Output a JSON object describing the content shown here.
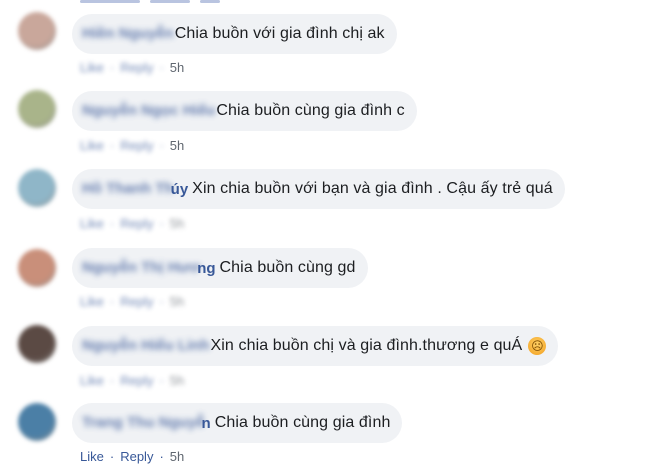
{
  "colors": {
    "bubble_bg": "#f0f2f5",
    "name": "#385898",
    "text": "#1c1e21",
    "meta": "#606770"
  },
  "comments": [
    {
      "avatar_color": "#c9a79b",
      "name_blurred": "Hiền Nguyễn",
      "name_tail": "",
      "text": "Chia buồn với gia đình chị ak",
      "like_label": "Like",
      "reply_label": "Reply",
      "time": "5h",
      "emoji": ""
    },
    {
      "avatar_color": "#a9b48a",
      "name_blurred": "Nguyễn Ngọc Hiếu",
      "name_tail": "",
      "text": "Chia buồn cùng gia đình c",
      "like_label": "Like",
      "reply_label": "Reply",
      "time": "5h",
      "emoji": ""
    },
    {
      "avatar_color": "#8fb6c8",
      "name_blurred": "Hồ Thanh Th",
      "name_tail": "úy",
      "text": "Xin chia buồn với bạn và gia đình . Cậu ấy trẻ quá",
      "like_label": "Like",
      "reply_label": "Reply",
      "time": "5h",
      "emoji": ""
    },
    {
      "avatar_color": "#c98f7a",
      "name_blurred": "Nguyễn Thị Hươ",
      "name_tail": "ng",
      "text": "Chia buồn cùng gd",
      "like_label": "Like",
      "reply_label": "Reply",
      "time": "5h",
      "emoji": ""
    },
    {
      "avatar_color": "#5b4a44",
      "name_blurred": "Nguyễn Hiểu Linh",
      "name_tail": "",
      "text": "Xin chia buồn chị và gia đình.thương e quÁ",
      "like_label": "Like",
      "reply_label": "Reply",
      "time": "5h",
      "emoji": "sad-face"
    },
    {
      "avatar_color": "#4b7fa6",
      "name_blurred": "Trang Thu Nguyễ",
      "name_tail": "n",
      "text": "Chia buồn cùng gia đình",
      "like_label": "Like",
      "reply_label": "Reply",
      "time": "5h",
      "emoji": ""
    }
  ]
}
